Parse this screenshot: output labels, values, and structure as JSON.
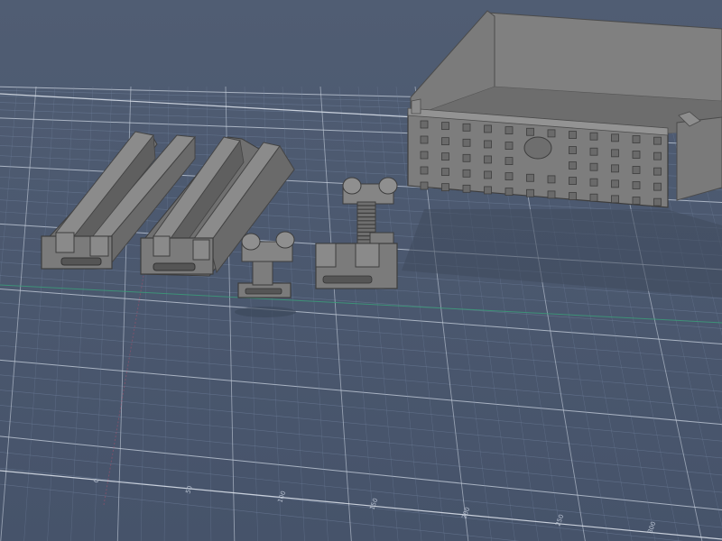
{
  "viewport": {
    "background_top": "#505d73",
    "background_bottom": "#46536a",
    "grid_minor_color": "#7384a0",
    "grid_major_color": "#c9d2df",
    "axis_x_color": "#3aa07a",
    "axis_y_color": "#b0506a",
    "model_color": "#767676",
    "model_dark": "#4b4b4b",
    "model_light": "#8d8d8d"
  },
  "ruler": {
    "ticks": [
      "0",
      "50",
      "100",
      "150",
      "200",
      "250",
      "300"
    ]
  },
  "objects": [
    {
      "name": "rail-long-1",
      "kind": "rail-profile"
    },
    {
      "name": "rail-long-2",
      "kind": "rail-profile"
    },
    {
      "name": "clip-single",
      "kind": "connector"
    },
    {
      "name": "clip-double",
      "kind": "connector"
    },
    {
      "name": "drawer-box",
      "kind": "drawer"
    }
  ]
}
